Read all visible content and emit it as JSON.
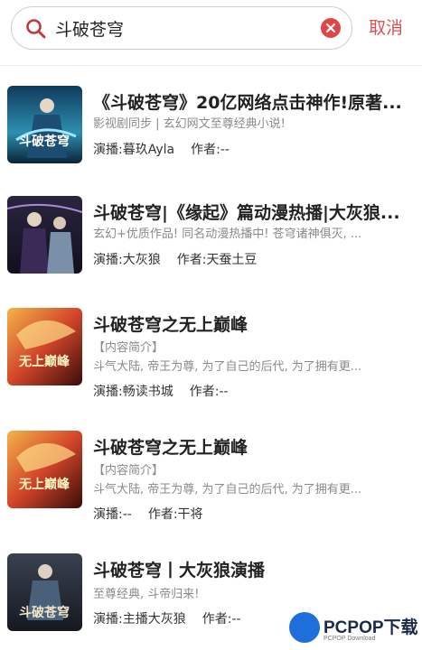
{
  "search": {
    "query": "斗破苍穹",
    "cancel_label": "取消"
  },
  "results": [
    {
      "title": "《斗破苍穹》20亿网络点击神作!原著...",
      "desc": "影视剧同步 | 玄幻网文至尊经典小说!",
      "narrator_label": "演播:",
      "narrator": "暮玖Ayla",
      "author_label": "作者:",
      "author": "--",
      "cover_text": "斗破苍穹"
    },
    {
      "title": "斗破苍穹|《缘起》篇动漫热播|大灰狼...",
      "desc": "玄幻+优质作品! 同名动漫热播中! 苍穹诸神俱灭, ...",
      "narrator_label": "演播:",
      "narrator": "大灰狼",
      "author_label": "作者:",
      "author": "天蚕土豆",
      "cover_text": ""
    },
    {
      "title": "斗破苍穹之无上巅峰",
      "desc1": "【内容简介】",
      "desc": "斗气大陆, 帝王为尊, 为了自己的后代, 为了拥有更...",
      "narrator_label": "演播:",
      "narrator": "畅读书城",
      "author_label": "作者:",
      "author": "--",
      "cover_text": "无上巅峰"
    },
    {
      "title": "斗破苍穹之无上巅峰",
      "desc1": "【内容简介】",
      "desc": "斗气大陆, 帝王为尊, 为了自己的后代, 为了拥有更...",
      "narrator_label": "演播:",
      "narrator": "--",
      "author_label": "作者:",
      "author": "干将",
      "cover_text": "无上巅峰"
    },
    {
      "title": "斗破苍穹丨大灰狼演播",
      "desc": "至尊经典, 斗帝归来!",
      "narrator_label": "演播:",
      "narrator": "主播大灰狼",
      "author_label": "作者:",
      "author": "--",
      "cover_text": "斗破苍穹"
    }
  ],
  "watermark": {
    "brand": "PCPOP下载",
    "sub": "PCPOP Download"
  },
  "colors": {
    "accent": "#d9534f",
    "clear": "#e04646"
  }
}
